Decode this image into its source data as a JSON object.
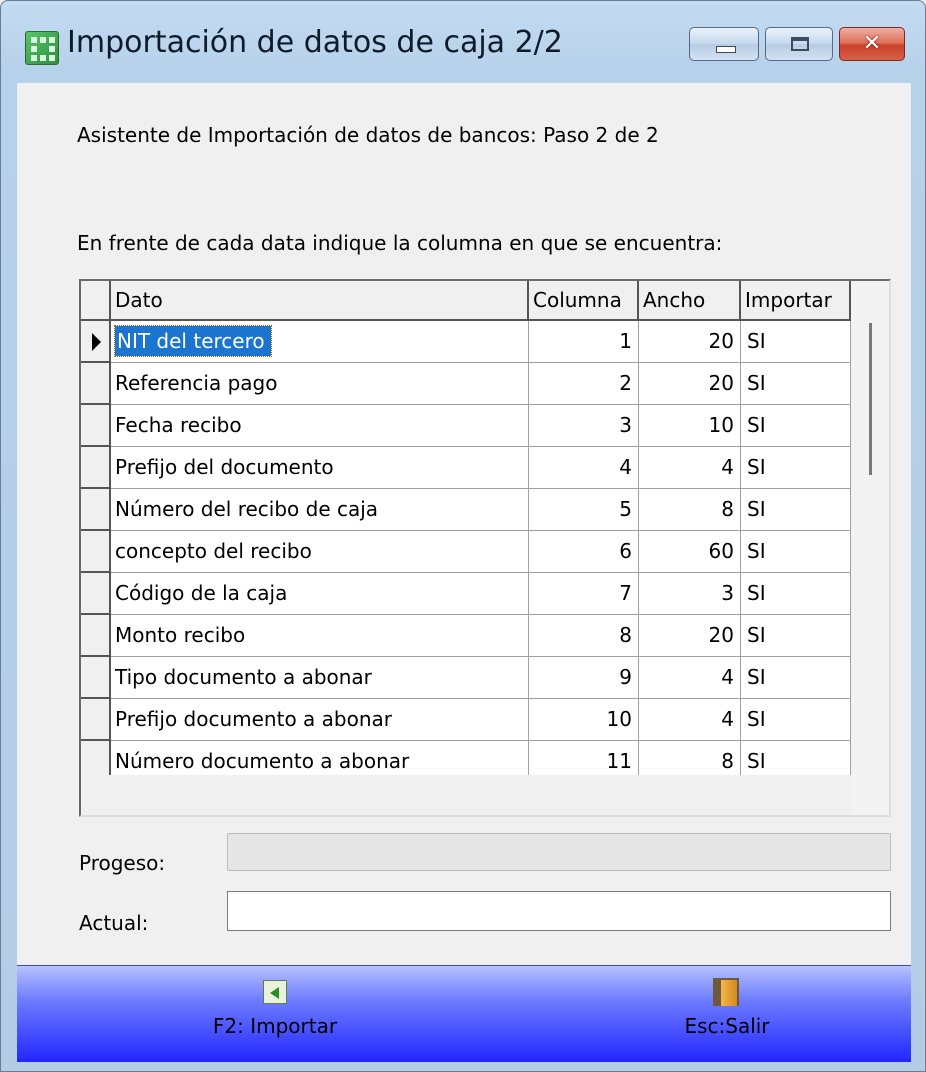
{
  "window": {
    "title": "Importación de datos de caja 2/2",
    "icon": "app-grid-icon",
    "controls": {
      "minimize": "minimize-icon",
      "maximize": "maximize-icon",
      "close": "close-icon",
      "close_glyph": "✕"
    }
  },
  "wizard": {
    "step_text": "Asistente de Importación de datos de bancos: Paso 2 de 2",
    "instruction": "En frente de cada data indique la columna en que se encuentra:"
  },
  "grid": {
    "columns": [
      "Dato",
      "Columna",
      "Ancho",
      "Importar"
    ],
    "current_row_index": 0,
    "rows": [
      {
        "dato": "NIT del tercero",
        "columna": "1",
        "ancho": "20",
        "importar": "SI"
      },
      {
        "dato": "Referencia pago",
        "columna": "2",
        "ancho": "20",
        "importar": "SI"
      },
      {
        "dato": "Fecha recibo",
        "columna": "3",
        "ancho": "10",
        "importar": "SI"
      },
      {
        "dato": "Prefijo del documento",
        "columna": "4",
        "ancho": "4",
        "importar": "SI"
      },
      {
        "dato": "Número del recibo de caja",
        "columna": "5",
        "ancho": "8",
        "importar": "SI"
      },
      {
        "dato": "concepto del recibo",
        "columna": "6",
        "ancho": "60",
        "importar": "SI"
      },
      {
        "dato": "Código de la caja",
        "columna": "7",
        "ancho": "3",
        "importar": "SI"
      },
      {
        "dato": "Monto recibo",
        "columna": "8",
        "ancho": "20",
        "importar": "SI"
      },
      {
        "dato": "Tipo documento a abonar",
        "columna": "9",
        "ancho": "4",
        "importar": "SI"
      },
      {
        "dato": "Prefijo documento a abonar",
        "columna": "10",
        "ancho": "4",
        "importar": "SI"
      },
      {
        "dato": "Número documento a abonar",
        "columna": "11",
        "ancho": "8",
        "importar": "SI"
      }
    ]
  },
  "progress": {
    "label": "Progeso:",
    "value": 0,
    "bar_color": "#06b025"
  },
  "actual": {
    "label": "Actual:",
    "value": ""
  },
  "footer": {
    "import_label": "F2: Importar",
    "import_icon": "import-icon",
    "exit_label": "Esc:Salir",
    "exit_icon": "door-exit-icon"
  },
  "colors": {
    "selection": "#1b74d0",
    "footer_gradient_bottom": "#2326ff"
  }
}
